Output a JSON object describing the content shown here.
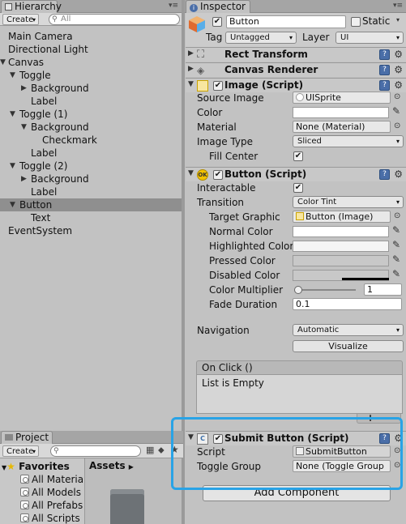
{
  "hierarchy": {
    "tab_label": "Hierarchy",
    "create_label": "Create",
    "search_placeholder": "All",
    "items": [
      {
        "label": "Main Camera"
      },
      {
        "label": "Directional Light"
      },
      {
        "label": "Canvas"
      },
      {
        "label": "Toggle"
      },
      {
        "label": "Background"
      },
      {
        "label": "Label"
      },
      {
        "label": "Toggle (1)"
      },
      {
        "label": "Background"
      },
      {
        "label": "Checkmark"
      },
      {
        "label": "Label"
      },
      {
        "label": "Toggle (2)"
      },
      {
        "label": "Background"
      },
      {
        "label": "Label"
      },
      {
        "label": "Button"
      },
      {
        "label": "Text"
      },
      {
        "label": "EventSystem"
      }
    ]
  },
  "project": {
    "tab_label": "Project",
    "create_label": "Create",
    "favorites_label": "Favorites",
    "assets_label": "Assets",
    "favorites": [
      {
        "label": "All Material"
      },
      {
        "label": "All Models"
      },
      {
        "label": "All Prefabs"
      },
      {
        "label": "All Scripts"
      }
    ]
  },
  "inspector": {
    "tab_label": "Inspector",
    "object_name": "Button",
    "static_label": "Static",
    "tag_label": "Tag",
    "tag_value": "Untagged",
    "layer_label": "Layer",
    "layer_value": "UI",
    "rect_transform": {
      "title": "Rect Transform"
    },
    "canvas_renderer": {
      "title": "Canvas Renderer"
    },
    "image": {
      "title": "Image (Script)",
      "source_image_label": "Source Image",
      "source_image_value": "UISprite",
      "color_label": "Color",
      "material_label": "Material",
      "material_value": "None (Material)",
      "image_type_label": "Image Type",
      "image_type_value": "Sliced",
      "fill_center_label": "Fill Center"
    },
    "button": {
      "title": "Button (Script)",
      "icon_text": "OK",
      "interactable_label": "Interactable",
      "transition_label": "Transition",
      "transition_value": "Color Tint",
      "target_graphic_label": "Target Graphic",
      "target_graphic_value": "Button (Image)",
      "normal_color_label": "Normal Color",
      "highlighted_color_label": "Highlighted Color",
      "pressed_color_label": "Pressed Color",
      "disabled_color_label": "Disabled Color",
      "color_multiplier_label": "Color Multiplier",
      "color_multiplier_value": "1",
      "color_multiplier_level": 0,
      "fade_duration_label": "Fade Duration",
      "fade_duration_value": "0.1",
      "navigation_label": "Navigation",
      "navigation_value": "Automatic",
      "visualize_label": "Visualize",
      "on_click_label": "On Click ()",
      "list_empty_label": "List is Empty",
      "add_label": "+",
      "remove_label": "-"
    },
    "submit_button": {
      "title": "Submit Button (Script)",
      "script_label": "Script",
      "script_value": "SubmitButton",
      "toggle_group_label": "Toggle Group",
      "toggle_group_value": "None (Toggle Group"
    },
    "add_component_label": "Add Component"
  },
  "colors": {
    "highlight_border": "#29a3e6",
    "selection": "#8f8f8f",
    "panel_bg": "#c2c2c2"
  }
}
